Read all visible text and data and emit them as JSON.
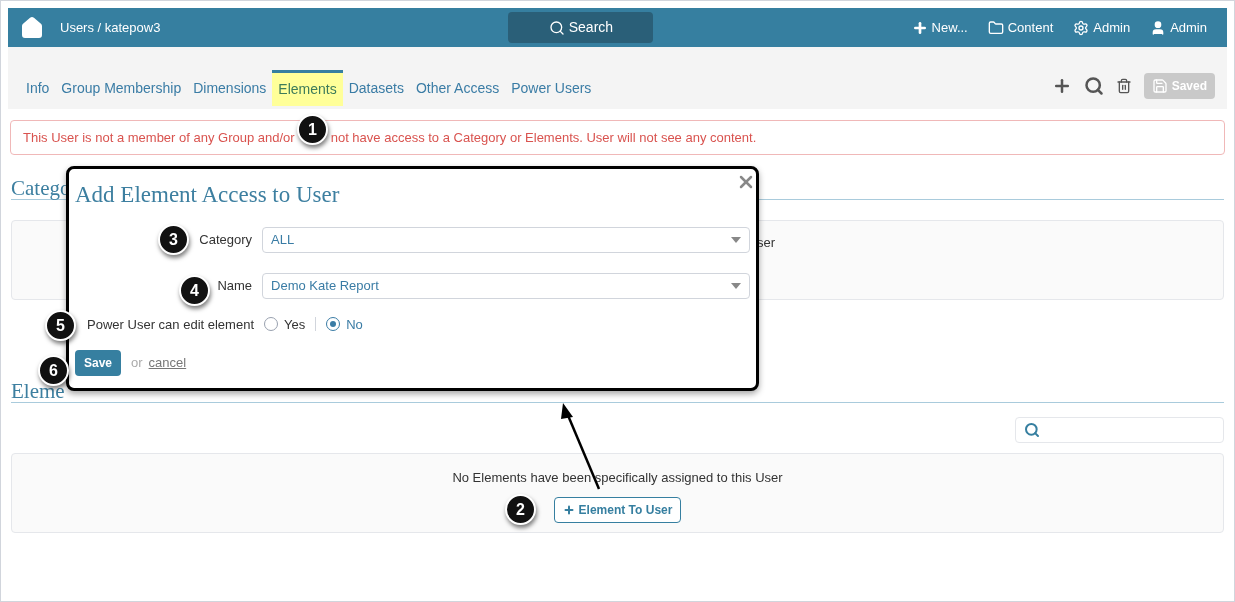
{
  "header": {
    "breadcrumb": "Users / katepow3",
    "search_button": "Search",
    "menu": [
      {
        "kind": "new",
        "label": "New..."
      },
      {
        "kind": "folder",
        "label": "Content"
      },
      {
        "kind": "settings",
        "label": "Admin"
      },
      {
        "kind": "user",
        "label": "Admin"
      }
    ]
  },
  "tabs": [
    {
      "label": "Info",
      "selected": false
    },
    {
      "label": "Group Membership",
      "selected": false
    },
    {
      "label": "Dimensions",
      "selected": false
    },
    {
      "label": "Elements",
      "selected": true
    },
    {
      "label": "Datasets",
      "selected": false
    },
    {
      "label": "Other Access",
      "selected": false
    },
    {
      "label": "Power Users",
      "selected": false
    }
  ],
  "toolbar": {
    "save_button": "Saved",
    "disabled": true
  },
  "alert": {
    "texts": [
      "This User is not a member of any Group and/or",
      "not have access to a Category or Elements. User will not see any content."
    ]
  },
  "categories_section": {
    "heading": "Catego",
    "box_text": "ser"
  },
  "elements_section": {
    "heading": "Eleme",
    "empty_text": "No Elements have been specifically assigned to this User",
    "add_button": "Element To User"
  },
  "dialog": {
    "title": "Add Element Access to User",
    "fields": [
      {
        "label": "Category",
        "value": "ALL"
      },
      {
        "label": "Name",
        "value": "Demo Kate Report"
      }
    ],
    "option": {
      "label": "Power User can edit element",
      "choices": [
        {
          "label": "Yes",
          "selected": false
        },
        {
          "label": "No",
          "selected": true
        }
      ]
    },
    "save_button": "Save",
    "or_text": "or",
    "cancel_link": "cancel"
  },
  "callouts": [
    "1",
    "2",
    "3",
    "4",
    "5",
    "6"
  ]
}
